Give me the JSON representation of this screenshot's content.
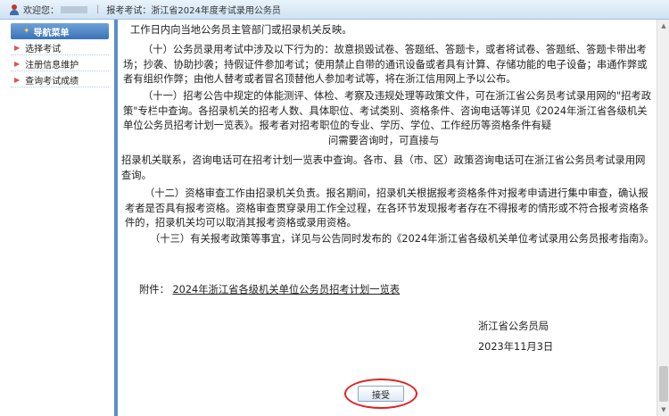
{
  "topbar": {
    "welcome": "欢迎您：",
    "exam_label": "报考考试：",
    "exam_name": "浙江省2024年度考试录用公务员"
  },
  "sidebar": {
    "header": "导航菜单",
    "items": [
      {
        "label": "选择考试"
      },
      {
        "label": "注册信息维护"
      },
      {
        "label": "查询考试成绩"
      }
    ]
  },
  "content": {
    "p0": "工作日内向当地公务员主管部门或招录机关反映。",
    "p1": "（十）公务员录用考试中涉及以下行为的：故意损毁试卷、答题纸、答题卡，或者将试卷、答题纸、答题卡带出考场；抄袭、协助抄袭；持假证件参加考试；使用禁止自带的通讯设备或者具有计算、存储功能的电子设备；串通作弊或者有组织作弊；由他人替考或者冒名顶替他人参加考试等，将在浙江信用网上予以公布。",
    "p2": "（十一）招考公告中规定的体能测评、体检、考察及违规处理等政策文件，可在浙江省公务员考试录用网的\"招考政策\"专栏中查询。各招录机关的招考人数、具体职位、考试类别、资格条件、咨询电话等详见《2024年浙江省各级机关单位公务员招考计划一览表》。报考者对招考职位的专业、学历、学位、工作经历等资格条件有疑",
    "p2b": "问需要咨询时，可直接与",
    "p3": "招录机关联系，咨询电话可在招考计划一览表中查询。各市、县（市、区）政策咨询电话可在浙江省公务员考试录用网查询。",
    "p4": "（十二）资格审查工作由招录机关负责。报名期间，招录机关根据报考资格条件对报考申请进行集中审查，确认报考者是否具有报考资格。资格审查贯穿录用工作全过程，在各环节发现报考者存在不得报考的情形或不符合报考资格条件的，招录机关均可以取消其报考资格或录用资格。",
    "p5": "（十三）有关报考政策等事宜，详见与公告同时发布的《2024年浙江省各级机关单位考试录用公务员报考指南》。",
    "attach_label": "附件：",
    "attach_link": "2024年浙江省各级机关单位公务员招考计划一览表",
    "signer": "浙江省公务员局",
    "date": "2023年11月3日",
    "accept_label": "接受"
  },
  "colors": {
    "accent": "#3a73b8",
    "highlight": "#e02020"
  }
}
